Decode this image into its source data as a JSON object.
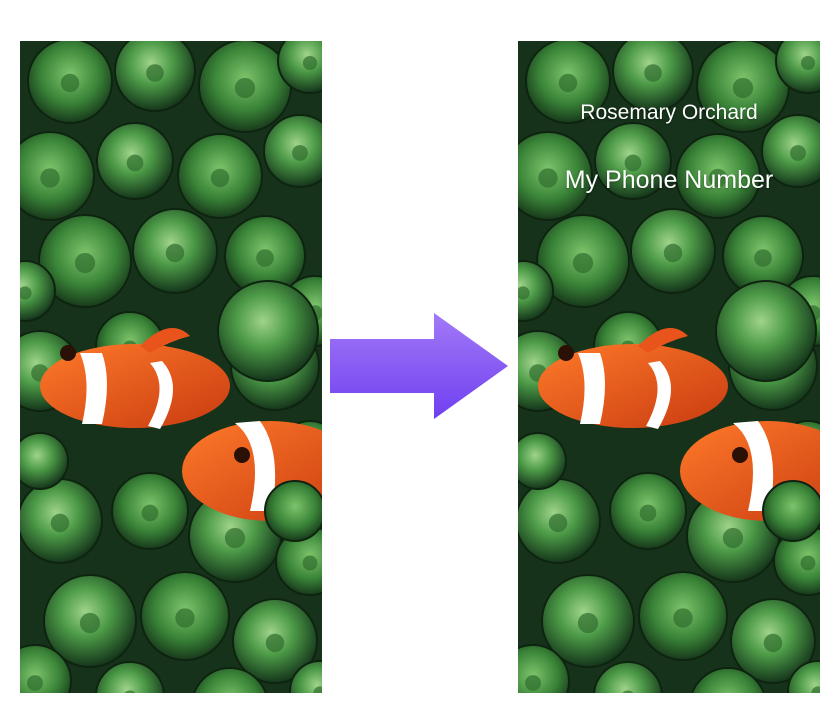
{
  "screens": {
    "before": {
      "wallpaper": "clownfish-anemone"
    },
    "after": {
      "wallpaper": "clownfish-anemone",
      "owner_name": "Rosemary Orchard",
      "phone_label": "My Phone Number"
    }
  },
  "arrow": {
    "icon": "right-arrow-icon",
    "color": "#8b5cf6"
  },
  "colors": {
    "anemone_dark": "#1f4f22",
    "anemone_mid": "#3f8f3e",
    "anemone_light": "#8fce74",
    "fish_orange": "#e8541c",
    "fish_white": "#ffffff"
  }
}
